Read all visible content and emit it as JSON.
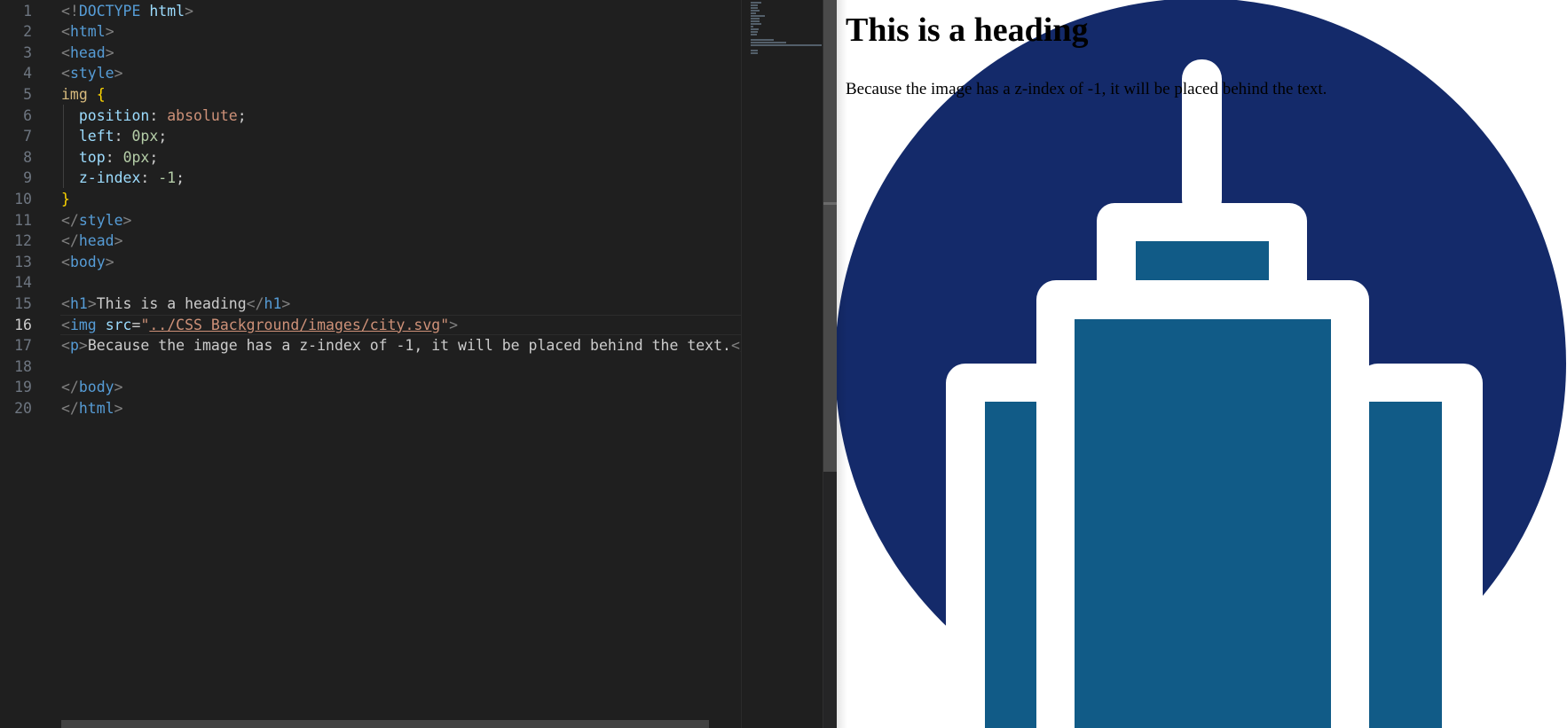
{
  "editor": {
    "active_line": 16,
    "lines": [
      {
        "num": "1",
        "tokens": [
          [
            "punct",
            "<!"
          ],
          [
            "doctype",
            "DOCTYPE "
          ],
          [
            "attr",
            "html"
          ],
          [
            "punct",
            ">"
          ]
        ]
      },
      {
        "num": "2",
        "tokens": [
          [
            "punct",
            "<"
          ],
          [
            "tag",
            "html"
          ],
          [
            "punct",
            ">"
          ]
        ]
      },
      {
        "num": "3",
        "tokens": [
          [
            "punct",
            "<"
          ],
          [
            "tag",
            "head"
          ],
          [
            "punct",
            ">"
          ]
        ]
      },
      {
        "num": "4",
        "tokens": [
          [
            "punct",
            "<"
          ],
          [
            "tag",
            "style"
          ],
          [
            "punct",
            ">"
          ]
        ]
      },
      {
        "num": "5",
        "tokens": [
          [
            "sel",
            "img "
          ],
          [
            "brace",
            "{"
          ]
        ]
      },
      {
        "num": "6",
        "tokens": [
          [
            "text",
            "  "
          ],
          [
            "prop",
            "position"
          ],
          [
            "text",
            ": "
          ],
          [
            "val",
            "absolute"
          ],
          [
            "text",
            ";"
          ]
        ]
      },
      {
        "num": "7",
        "tokens": [
          [
            "text",
            "  "
          ],
          [
            "prop",
            "left"
          ],
          [
            "text",
            ": "
          ],
          [
            "num",
            "0px"
          ],
          [
            "text",
            ";"
          ]
        ]
      },
      {
        "num": "8",
        "tokens": [
          [
            "text",
            "  "
          ],
          [
            "prop",
            "top"
          ],
          [
            "text",
            ": "
          ],
          [
            "num",
            "0px"
          ],
          [
            "text",
            ";"
          ]
        ]
      },
      {
        "num": "9",
        "tokens": [
          [
            "text",
            "  "
          ],
          [
            "prop",
            "z-index"
          ],
          [
            "text",
            ": "
          ],
          [
            "num",
            "-1"
          ],
          [
            "text",
            ";"
          ]
        ]
      },
      {
        "num": "10",
        "tokens": [
          [
            "brace",
            "}"
          ]
        ]
      },
      {
        "num": "11",
        "tokens": [
          [
            "punct",
            "</"
          ],
          [
            "tag",
            "style"
          ],
          [
            "punct",
            ">"
          ]
        ]
      },
      {
        "num": "12",
        "tokens": [
          [
            "punct",
            "</"
          ],
          [
            "tag",
            "head"
          ],
          [
            "punct",
            ">"
          ]
        ]
      },
      {
        "num": "13",
        "tokens": [
          [
            "punct",
            "<"
          ],
          [
            "tag",
            "body"
          ],
          [
            "punct",
            ">"
          ]
        ]
      },
      {
        "num": "14",
        "tokens": []
      },
      {
        "num": "15",
        "tokens": [
          [
            "punct",
            "<"
          ],
          [
            "tag",
            "h1"
          ],
          [
            "punct",
            ">"
          ],
          [
            "text",
            "This is a heading"
          ],
          [
            "punct",
            "</"
          ],
          [
            "tag",
            "h1"
          ],
          [
            "punct",
            ">"
          ]
        ]
      },
      {
        "num": "16",
        "tokens": [
          [
            "punct",
            "<"
          ],
          [
            "tag",
            "img "
          ],
          [
            "attr",
            "src"
          ],
          [
            "text",
            "="
          ],
          [
            "str",
            "\""
          ],
          [
            "strlink",
            "../CSS Background/images/city.svg"
          ],
          [
            "str",
            "\""
          ],
          [
            "punct",
            ">"
          ]
        ]
      },
      {
        "num": "17",
        "tokens": [
          [
            "punct",
            "<"
          ],
          [
            "tag",
            "p"
          ],
          [
            "punct",
            ">"
          ],
          [
            "text",
            "Because the image has a z-index of -1, it will be placed behind the text."
          ],
          [
            "punct",
            "</"
          ],
          [
            "tag",
            "p"
          ],
          [
            "punct",
            ">"
          ]
        ]
      },
      {
        "num": "18",
        "tokens": []
      },
      {
        "num": "19",
        "tokens": [
          [
            "punct",
            "</"
          ],
          [
            "tag",
            "body"
          ],
          [
            "punct",
            ">"
          ]
        ]
      },
      {
        "num": "20",
        "tokens": [
          [
            "punct",
            "</"
          ],
          [
            "tag",
            "html"
          ],
          [
            "punct",
            ">"
          ]
        ]
      }
    ]
  },
  "preview": {
    "heading": "This is a heading",
    "paragraph": "Because the image has a z-index of -1, it will be placed behind the text.",
    "image_icon": "city-building-icon",
    "colors": {
      "circle": "#142a6a",
      "building_fill": "#115b87",
      "building_outline": "#ffffff"
    }
  }
}
